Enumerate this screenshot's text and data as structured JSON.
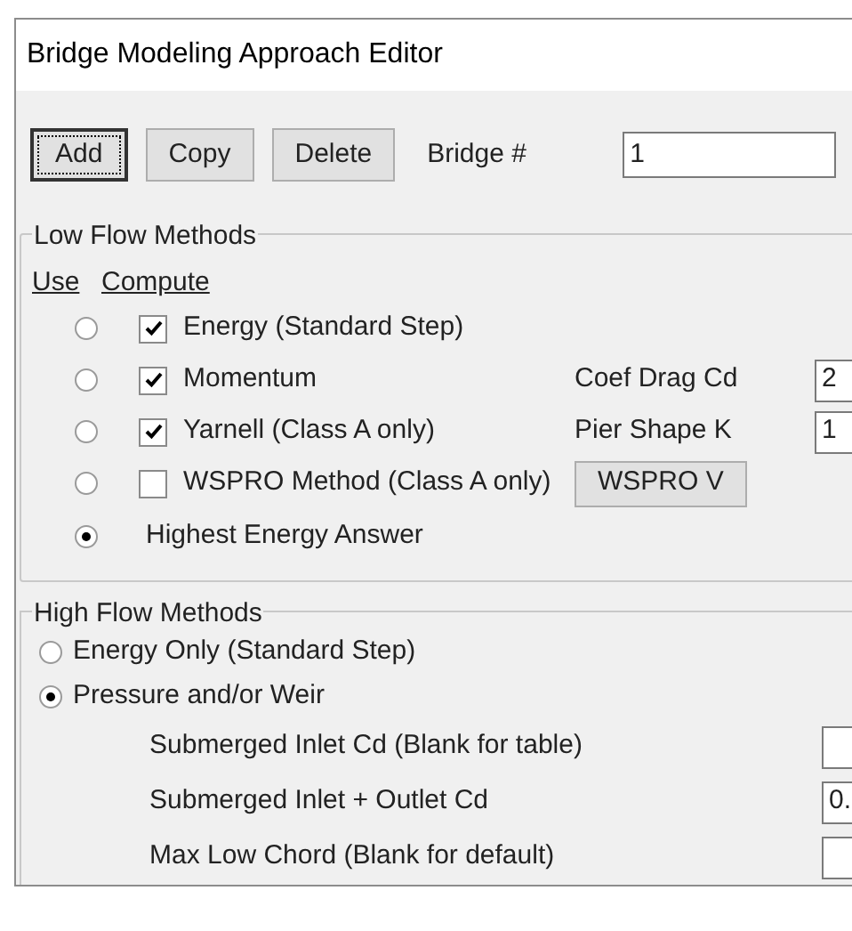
{
  "window": {
    "title": "Bridge Modeling Approach Editor"
  },
  "toolbar": {
    "buttons": [
      {
        "label": "Add",
        "focused": true
      },
      {
        "label": "Copy",
        "focused": false
      },
      {
        "label": "Delete",
        "focused": false
      }
    ],
    "bridge_number": {
      "label": "Bridge #",
      "value": "1"
    }
  },
  "low_flow": {
    "title": "Low Flow Methods",
    "use_header": "Use",
    "compute_header": "Compute",
    "methods": [
      {
        "kind": "method",
        "label": "Energy (Standard Step)",
        "selected": false,
        "checked": true
      },
      {
        "kind": "method",
        "label": "Momentum",
        "selected": false,
        "checked": true,
        "param": {
          "label": "Coef Drag Cd",
          "value": "2"
        }
      },
      {
        "kind": "method",
        "label": "Yarnell (Class A only)",
        "selected": false,
        "checked": true,
        "param": {
          "label": "Pier Shape K",
          "value": "1"
        }
      },
      {
        "kind": "method",
        "label": "WSPRO Method (Class A only)",
        "selected": false,
        "checked": false,
        "button": "WSPRO V"
      },
      {
        "kind": "answer",
        "label": "Highest Energy Answer",
        "selected": true
      }
    ]
  },
  "high_flow": {
    "title": "High Flow Methods",
    "options": [
      {
        "label": "Energy Only (Standard Step)",
        "selected": false
      },
      {
        "label": "Pressure and/or Weir",
        "selected": true
      }
    ],
    "params": [
      {
        "label": "Submerged Inlet Cd (Blank for table)"
      },
      {
        "label": "Submerged Inlet + Outlet Cd",
        "value": "0."
      },
      {
        "label": "Max Low Chord (Blank for default)"
      }
    ]
  }
}
